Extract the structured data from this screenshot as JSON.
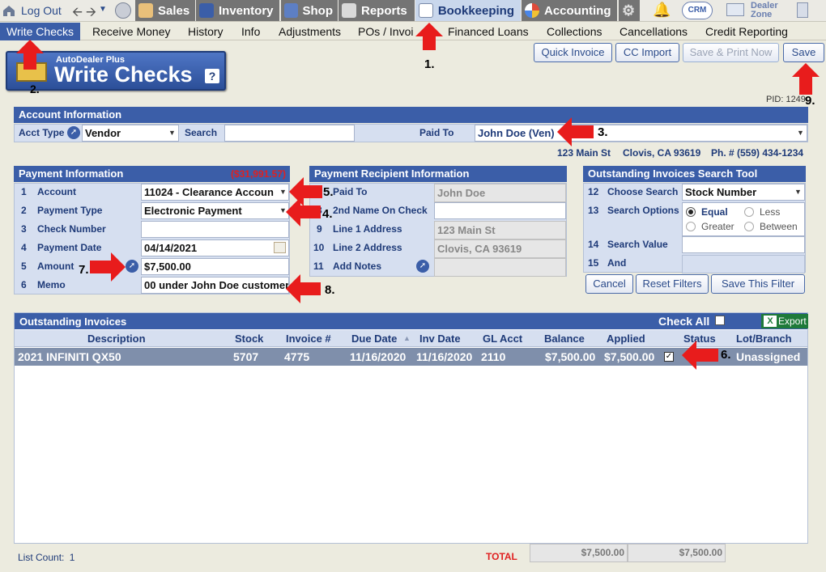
{
  "topnav": {
    "logout": "Log Out",
    "sales": "Sales",
    "inventory": "Inventory",
    "shop": "Shop",
    "reports": "Reports",
    "bookkeeping": "Bookkeeping",
    "accounting": "Accounting",
    "crm": "CRM",
    "dealer_zone_1": "Dealer",
    "dealer_zone_2": "Zone"
  },
  "subnav": [
    "Write Checks",
    "Receive Money",
    "History",
    "Info",
    "Adjustments",
    "POs / Invoi",
    "Financed Loans",
    "Collections",
    "Cancellations",
    "Credit Reporting"
  ],
  "header": {
    "brand": "AutoDealer Plus",
    "title": "Write Checks",
    "help": "?"
  },
  "actions": {
    "quick_invoice": "Quick Invoice",
    "cc_import": "CC Import",
    "save_print": "Save & Print Now",
    "save": "Save"
  },
  "pid": "PID: 1249",
  "account_info": {
    "title": "Account Information",
    "acct_type_label": "Acct Type",
    "acct_type_value": "Vendor",
    "search_label": "Search",
    "search_value": "",
    "paid_to_label": "Paid To",
    "paid_to_value": "John Doe (Ven)",
    "address": "123 Main St",
    "city": "Clovis, CA 93619",
    "phone": "Ph. # (559) 434-1234"
  },
  "payment_info": {
    "title": "Payment Information",
    "balance": "($31,991.57)",
    "rows": [
      {
        "n": "1",
        "label": "Account",
        "value": "11024 - Clearance Accoun"
      },
      {
        "n": "2",
        "label": "Payment Type",
        "value": "Electronic Payment"
      },
      {
        "n": "3",
        "label": "Check Number",
        "value": ""
      },
      {
        "n": "4",
        "label": "Payment Date",
        "value": "04/14/2021"
      },
      {
        "n": "5",
        "label": "Amount",
        "value": "$7,500.00"
      },
      {
        "n": "6",
        "label": "Memo",
        "value": "00 under John Doe customer"
      }
    ]
  },
  "recipient_info": {
    "title": "Payment Recipient Information",
    "rows": [
      {
        "n": "7",
        "label": "Paid To",
        "value": "John Doe"
      },
      {
        "n": "8",
        "label": "2nd Name On Check",
        "value": ""
      },
      {
        "n": "9",
        "label": "Line 1 Address",
        "value": "123 Main St"
      },
      {
        "n": "10",
        "label": "Line 2 Address",
        "value": "Clovis, CA 93619"
      },
      {
        "n": "11",
        "label": "Add Notes",
        "value": ""
      }
    ]
  },
  "search_tool": {
    "title": "Outstanding Invoices Search Tool",
    "rows": [
      {
        "n": "12",
        "label": "Choose Search",
        "value": "Stock Number"
      },
      {
        "n": "13",
        "label": "Search Options",
        "value": ""
      },
      {
        "n": "14",
        "label": "Search Value",
        "value": ""
      },
      {
        "n": "15",
        "label": "And",
        "value": ""
      }
    ],
    "options": [
      "Equal",
      "Less",
      "Greater",
      "Between"
    ],
    "buttons": {
      "cancel": "Cancel",
      "reset": "Reset Filters",
      "save_filter": "Save This Filter"
    }
  },
  "invoices": {
    "title": "Outstanding Invoices",
    "check_all": "Check All",
    "export": "Export",
    "columns": [
      "Description",
      "Stock",
      "Invoice #",
      "Due Date",
      "Inv Date",
      "GL Acct",
      "Balance",
      "Applied",
      "Status",
      "Lot/Branch"
    ],
    "rows": [
      {
        "description": "2021 INFINITI QX50",
        "stock": "5707",
        "invoice": "4775",
        "due": "11/16/2020",
        "inv": "11/16/2020",
        "gl": "2110",
        "balance": "$7,500.00",
        "applied": "$7,500.00",
        "lot": "Unassigned"
      }
    ],
    "list_count_label": "List Count:",
    "list_count": "1",
    "total_label": "TOTAL",
    "total_balance": "$7,500.00",
    "total_applied": "$7,500.00"
  },
  "annotations": [
    "1.",
    "2.",
    "3.",
    "4.",
    "5.",
    "6.",
    "7.",
    "8.",
    "9."
  ]
}
